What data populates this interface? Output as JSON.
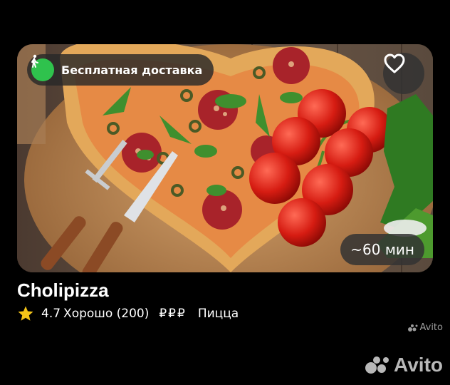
{
  "card": {
    "delivery_badge": "Бесплатная доставка",
    "delivery_icon": "walking-person-icon",
    "favorite_icon": "heart-icon",
    "delivery_time": "~60 мин",
    "title": "Cholipizza",
    "rating": "4.7",
    "rating_label": "Хорошо (200)",
    "price_level": "₽₽₽",
    "category": "Пицца",
    "star_color": "#f5c518",
    "badge_icon_color": "#2fc24d"
  },
  "watermark": {
    "small": "Avito",
    "large": "Avito"
  }
}
